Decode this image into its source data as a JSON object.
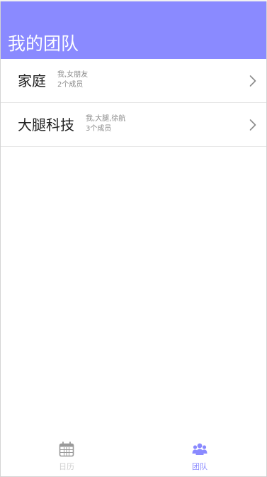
{
  "header": {
    "title": "我的团队",
    "background": "#8a8aff"
  },
  "teams": [
    {
      "name": "家庭",
      "members": "我,女朋友",
      "count": "2个成员"
    },
    {
      "name": "大腿科技",
      "members": "我,大腿,徐航",
      "count": "3个成员"
    }
  ],
  "tabbar": {
    "tabs": [
      {
        "label": "日历",
        "icon": "calendar-icon",
        "active": false,
        "color": "#cfcfcf"
      },
      {
        "label": "团队",
        "icon": "team-icon",
        "active": true,
        "color": "#8a8aff"
      }
    ]
  }
}
